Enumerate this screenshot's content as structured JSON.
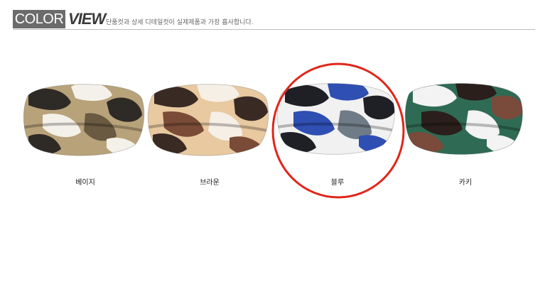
{
  "header": {
    "badge_text": "COLOR",
    "view_text": "VIEW",
    "subtitle": "단품컷과 상세 디테일컷이 실제제품과 가장 흡사합니다."
  },
  "products": [
    {
      "label": "베이지",
      "palette": [
        "#b8a27a",
        "#2e2a26",
        "#f4f1ea",
        "#6a5a42"
      ]
    },
    {
      "label": "브라운",
      "palette": [
        "#e8c9a0",
        "#3a2a24",
        "#f5efe6",
        "#7a4b36"
      ]
    },
    {
      "label": "블루",
      "palette": [
        "#2f4fb3",
        "#1f2026",
        "#f1f1f1",
        "#6f7b86"
      ]
    },
    {
      "label": "카키",
      "palette": [
        "#2f6b54",
        "#2a1f1b",
        "#f3f3f3",
        "#7a4a3a"
      ]
    }
  ],
  "highlight": {
    "color": "#e0261b",
    "target": "블루"
  }
}
